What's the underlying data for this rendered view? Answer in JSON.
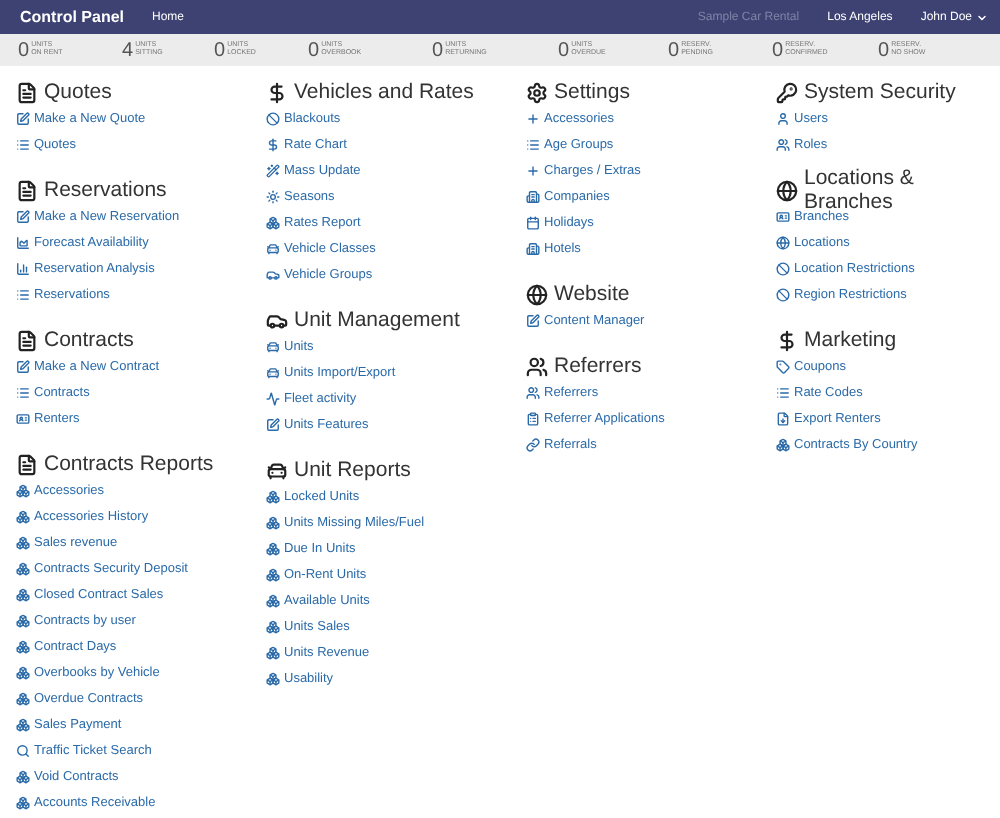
{
  "navbar": {
    "brand": "Control Panel",
    "links": [
      "Home"
    ],
    "company": "Sample Car Rental",
    "location": "Los Angeles",
    "user": "John Doe"
  },
  "stats": [
    {
      "value": "0",
      "label": "UNITS\nON RENT"
    },
    {
      "value": "4",
      "label": "UNITS\nSITTING"
    },
    {
      "value": "0",
      "label": "UNITS\nLOCKED"
    },
    {
      "value": "0",
      "label": "UNITS\nOVERBOOK"
    },
    {
      "value": "0",
      "label": "UNITS\nRETURNING"
    },
    {
      "value": "0",
      "label": "UNITS\nOVERDUE"
    },
    {
      "value": "0",
      "label": "RESERV.\nPENDING"
    },
    {
      "value": "0",
      "label": "RESERV.\nCONFIRMED"
    },
    {
      "value": "0",
      "label": "RESERV.\nNO SHOW"
    }
  ],
  "columns": [
    {
      "sections": [
        {
          "title": "Quotes",
          "kind": "file",
          "items": [
            {
              "label": "Make a New Quote",
              "kind": "edit"
            },
            {
              "label": "Quotes",
              "kind": "list"
            }
          ]
        },
        {
          "title": "Reservations",
          "kind": "file",
          "items": [
            {
              "label": "Make a New Reservation",
              "kind": "edit"
            },
            {
              "label": "Forecast Availability",
              "kind": "area"
            },
            {
              "label": "Reservation Analysis",
              "kind": "bars"
            },
            {
              "label": "Reservations",
              "kind": "list"
            }
          ]
        },
        {
          "title": "Contracts",
          "kind": "file",
          "items": [
            {
              "label": "Make a New Contract",
              "kind": "edit"
            },
            {
              "label": "Contracts",
              "kind": "list"
            },
            {
              "label": "Renters",
              "kind": "card"
            }
          ]
        },
        {
          "title": "Contracts Reports",
          "kind": "file",
          "items": [
            {
              "label": "Accessories",
              "kind": "report"
            },
            {
              "label": "Accessories History",
              "kind": "report"
            },
            {
              "label": "Sales revenue",
              "kind": "report"
            },
            {
              "label": "Contracts Security Deposit",
              "kind": "report"
            },
            {
              "label": "Closed Contract Sales",
              "kind": "report"
            },
            {
              "label": "Contracts by user",
              "kind": "report"
            },
            {
              "label": "Contract Days",
              "kind": "report"
            },
            {
              "label": "Overbooks by Vehicle",
              "kind": "report"
            },
            {
              "label": "Overdue Contracts",
              "kind": "report"
            },
            {
              "label": "Sales Payment",
              "kind": "report"
            },
            {
              "label": "Traffic Ticket Search",
              "kind": "search"
            },
            {
              "label": "Void Contracts",
              "kind": "report"
            },
            {
              "label": "Accounts Receivable",
              "kind": "report"
            }
          ]
        }
      ]
    },
    {
      "sections": [
        {
          "title": "Vehicles and Rates",
          "kind": "dollar",
          "items": [
            {
              "label": "Blackouts",
              "kind": "ban"
            },
            {
              "label": "Rate Chart",
              "kind": "dollar"
            },
            {
              "label": "Mass Update",
              "kind": "wand"
            },
            {
              "label": "Seasons",
              "kind": "sun"
            },
            {
              "label": "Rates Report",
              "kind": "report"
            },
            {
              "label": "Vehicle Classes",
              "kind": "car"
            },
            {
              "label": "Vehicle Groups",
              "kind": "cars"
            }
          ]
        },
        {
          "title": "Unit Management",
          "kind": "cars",
          "items": [
            {
              "label": "Units",
              "kind": "car"
            },
            {
              "label": "Units Import/Export",
              "kind": "car"
            },
            {
              "label": "Fleet activity",
              "kind": "activity"
            },
            {
              "label": "Units Features",
              "kind": "edit"
            }
          ]
        },
        {
          "title": "Unit Reports",
          "kind": "car",
          "items": [
            {
              "label": "Locked Units",
              "kind": "report"
            },
            {
              "label": "Units Missing Miles/Fuel",
              "kind": "report"
            },
            {
              "label": "Due In Units",
              "kind": "report"
            },
            {
              "label": "On-Rent Units",
              "kind": "report"
            },
            {
              "label": "Available Units",
              "kind": "report"
            },
            {
              "label": "Units Sales",
              "kind": "report"
            },
            {
              "label": "Units Revenue",
              "kind": "report"
            },
            {
              "label": "Usability",
              "kind": "report"
            }
          ]
        }
      ]
    },
    {
      "sections": [
        {
          "title": "Settings",
          "kind": "gear",
          "items": [
            {
              "label": "Accessories",
              "kind": "plus"
            },
            {
              "label": "Age Groups",
              "kind": "list"
            },
            {
              "label": "Charges / Extras",
              "kind": "plus"
            },
            {
              "label": "Companies",
              "kind": "building"
            },
            {
              "label": "Holidays",
              "kind": "calendar"
            },
            {
              "label": "Hotels",
              "kind": "building"
            }
          ]
        },
        {
          "title": "Website",
          "kind": "globe",
          "items": [
            {
              "label": "Content Manager",
              "kind": "edit"
            }
          ]
        },
        {
          "title": "Referrers",
          "kind": "users",
          "items": [
            {
              "label": "Referrers",
              "kind": "users"
            },
            {
              "label": "Referrer Applications",
              "kind": "clipboard"
            },
            {
              "label": "Referrals",
              "kind": "link"
            }
          ]
        }
      ]
    },
    {
      "sections": [
        {
          "title": "System Security",
          "kind": "key",
          "items": [
            {
              "label": "Users",
              "kind": "user"
            },
            {
              "label": "Roles",
              "kind": "users"
            }
          ]
        },
        {
          "title": "Locations & Branches",
          "kind": "globe",
          "items": [
            {
              "label": "Branches",
              "kind": "card"
            },
            {
              "label": "Locations",
              "kind": "globe"
            },
            {
              "label": "Location Restrictions",
              "kind": "ban"
            },
            {
              "label": "Region Restrictions",
              "kind": "ban"
            }
          ]
        },
        {
          "title": "Marketing",
          "kind": "dollar",
          "items": [
            {
              "label": "Coupons",
              "kind": "tag"
            },
            {
              "label": "Rate Codes",
              "kind": "list"
            },
            {
              "label": "Export Renters",
              "kind": "export"
            },
            {
              "label": "Contracts By Country",
              "kind": "report"
            }
          ]
        }
      ]
    }
  ]
}
